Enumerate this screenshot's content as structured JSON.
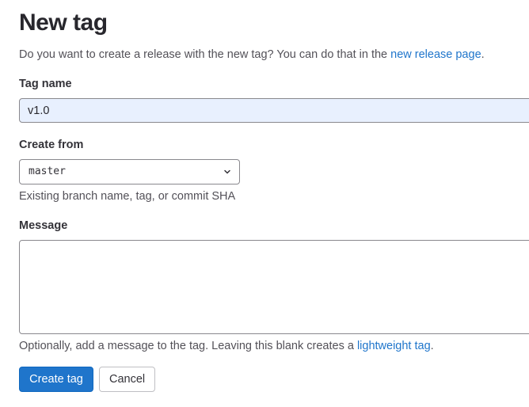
{
  "page": {
    "title": "New tag",
    "intro_text": "Do you want to create a release with the new tag? You can do that in the ",
    "intro_link": "new release page",
    "intro_end": "."
  },
  "tag_name": {
    "label": "Tag name",
    "value": "v1.0"
  },
  "create_from": {
    "label": "Create from",
    "selected": "master",
    "help": "Existing branch name, tag, or commit SHA",
    "icon": "chevron-down-icon"
  },
  "message": {
    "label": "Message",
    "value": "",
    "help_text": "Optionally, add a message to the tag. Leaving this blank creates a ",
    "help_link": "lightweight tag",
    "help_end": "."
  },
  "actions": {
    "create_label": "Create tag",
    "cancel_label": "Cancel"
  },
  "colors": {
    "primary": "#1f75cb",
    "link": "#1f75cb",
    "autofill_bg": "#e8f0fe"
  }
}
